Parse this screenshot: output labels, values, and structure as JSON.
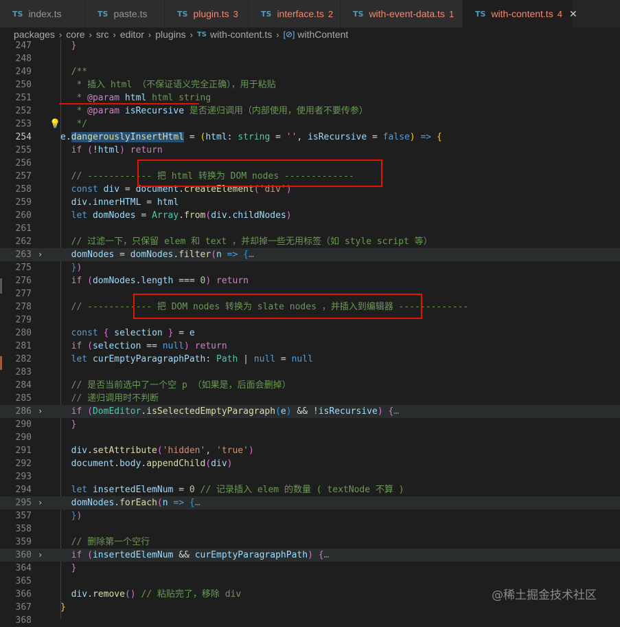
{
  "tabs": [
    {
      "label": "index.ts",
      "count": "",
      "error": false,
      "active": false,
      "width": 124
    },
    {
      "label": "paste.ts",
      "count": "",
      "error": false,
      "active": false,
      "width": 116
    },
    {
      "label": "plugin.ts",
      "count": "3",
      "error": true,
      "active": false,
      "width": 122
    },
    {
      "label": "interface.ts",
      "count": "2",
      "error": true,
      "active": false,
      "width": 134
    },
    {
      "label": "with-event-data.ts",
      "count": "1",
      "error": true,
      "active": false,
      "width": 178
    },
    {
      "label": "with-content.ts",
      "count": "4",
      "error": true,
      "active": true,
      "width": 160
    }
  ],
  "tab_ts_glyph": "TS",
  "tab_close_glyph": "✕",
  "breadcrumb": {
    "items": [
      "packages",
      "core",
      "src",
      "editor",
      "plugins"
    ],
    "file": "with-content.ts",
    "symbol": "withContent",
    "sep": "›"
  },
  "lines": [
    {
      "n": "247",
      "fold": false,
      "hl": false,
      "html": "  <span class=\"b2\">}</span>"
    },
    {
      "n": "248",
      "fold": false,
      "hl": false,
      "html": ""
    },
    {
      "n": "249",
      "fold": false,
      "hl": false,
      "html": "  <span class=\"c\">/**</span>"
    },
    {
      "n": "250",
      "fold": false,
      "hl": false,
      "html": "  <span class=\"c\"> * 插入 html （不保证语义完全正确），用于粘贴</span>"
    },
    {
      "n": "251",
      "fold": false,
      "hl": false,
      "html": "  <span class=\"c\"> * </span><span class=\"p\">@param</span><span class=\"v\"> html</span><span class=\"c\"> html string</span>"
    },
    {
      "n": "252",
      "fold": false,
      "hl": false,
      "html": "  <span class=\"c\"> * </span><span class=\"p\">@param</span><span class=\"v\"> isRecursive</span><span class=\"c\"> 是否递归调用（内部使用，使用者不要传参）</span>"
    },
    {
      "n": "253",
      "fold": false,
      "hl": false,
      "bulb": true,
      "html": "  <span class=\"c\"> */</span>"
    },
    {
      "n": "254",
      "fold": false,
      "hl": false,
      "cur": true,
      "html": "<span class=\"v\">e</span>.<span class=\"selword\"><span class=\"f\">dangerouslyInsertHtml</span></span> = <span class=\"b1\">(</span><span class=\"v\">html</span>: <span class=\"t\">string</span> = <span class=\"s\">''</span>, <span class=\"v\">isRecursive</span> = <span class=\"k\">false</span><span class=\"b1\">)</span> <span class=\"k\">=></span> <span class=\"b1\">{</span>"
    },
    {
      "n": "255",
      "fold": false,
      "hl": false,
      "html": "  <span class=\"p\">if</span> <span class=\"b2\">(</span>!<span class=\"v\">html</span><span class=\"b2\">)</span> <span class=\"p\">return</span>"
    },
    {
      "n": "256",
      "fold": false,
      "hl": false,
      "html": ""
    },
    {
      "n": "257",
      "fold": false,
      "hl": false,
      "html": "  <span class=\"c\">// ------------ 把 html 转换为 DOM nodes -------------</span>"
    },
    {
      "n": "258",
      "fold": false,
      "hl": false,
      "html": "  <span class=\"k\">const</span> <span class=\"v\">div</span> = <span class=\"v\">document</span>.<span class=\"f\">createElement</span><span class=\"b2\">(</span><span class=\"s\">'div'</span><span class=\"b2\">)</span>"
    },
    {
      "n": "259",
      "fold": false,
      "hl": false,
      "html": "  <span class=\"v\">div</span>.<span class=\"v\">innerHTML</span> = <span class=\"v\">html</span>"
    },
    {
      "n": "260",
      "fold": false,
      "hl": false,
      "html": "  <span class=\"k\">let</span> <span class=\"v\">domNodes</span> = <span class=\"t\">Array</span>.<span class=\"f\">from</span><span class=\"b2\">(</span><span class=\"v\">div</span>.<span class=\"v\">childNodes</span><span class=\"b2\">)</span>"
    },
    {
      "n": "261",
      "fold": false,
      "hl": false,
      "html": ""
    },
    {
      "n": "262",
      "fold": false,
      "hl": false,
      "html": "  <span class=\"c\">// 过滤一下，只保留 elem 和 text ，并却掉一些无用标签（如 style script 等）</span>"
    },
    {
      "n": "263",
      "fold": true,
      "hl": true,
      "html": "  <span class=\"v\">domNodes</span> = <span class=\"v\">domNodes</span>.<span class=\"f\">filter</span><span class=\"b2\">(</span><span class=\"v\">n</span> <span class=\"k\">=></span> <span class=\"b3\">{</span><span class=\"dd\">…</span>"
    },
    {
      "n": "275",
      "fold": false,
      "hl": false,
      "html": "  <span class=\"b3\">}</span><span class=\"b2\">)</span>"
    },
    {
      "n": "276",
      "fold": false,
      "hl": false,
      "html": "  <span class=\"p\">if</span> <span class=\"b2\">(</span><span class=\"v\">domNodes</span>.<span class=\"v\">length</span> === <span class=\"n\">0</span><span class=\"b2\">)</span> <span class=\"p\">return</span>"
    },
    {
      "n": "277",
      "fold": false,
      "hl": false,
      "html": ""
    },
    {
      "n": "278",
      "fold": false,
      "hl": false,
      "html": "  <span class=\"c\">// ------------ 把 DOM nodes 转换为 slate nodes ，并插入到编辑器 -------------</span>"
    },
    {
      "n": "279",
      "fold": false,
      "hl": false,
      "html": ""
    },
    {
      "n": "280",
      "fold": false,
      "hl": false,
      "html": "  <span class=\"k\">const</span> <span class=\"b2\">{</span> <span class=\"v\">selection</span> <span class=\"b2\">}</span> = <span class=\"v\">e</span>"
    },
    {
      "n": "281",
      "fold": false,
      "hl": false,
      "html": "  <span class=\"p\">if</span> <span class=\"b2\">(</span><span class=\"v\">selection</span> == <span class=\"k\">null</span><span class=\"b2\">)</span> <span class=\"p\">return</span>"
    },
    {
      "n": "282",
      "fold": false,
      "hl": false,
      "html": "  <span class=\"k\">let</span> <span class=\"v\">curEmptyParagraphPath</span>: <span class=\"t\">Path</span> | <span class=\"k\">null</span> = <span class=\"k\">null</span>"
    },
    {
      "n": "283",
      "fold": false,
      "hl": false,
      "html": ""
    },
    {
      "n": "284",
      "fold": false,
      "hl": false,
      "html": "  <span class=\"c\">// 是否当前选中了一个空 p （如果是，后面会删掉）</span>"
    },
    {
      "n": "285",
      "fold": false,
      "hl": false,
      "html": "  <span class=\"c\">// 递归调用时不判断</span>"
    },
    {
      "n": "286",
      "fold": true,
      "hl": true,
      "html": "  <span class=\"p\">if</span> <span class=\"b2\">(</span><span class=\"t\">DomEditor</span>.<span class=\"f\">isSelectedEmptyParagraph</span><span class=\"b3\">(</span><span class=\"v\">e</span><span class=\"b3\">)</span> && !<span class=\"v\">isRecursive</span><span class=\"b2\">)</span> <span class=\"b2\">{</span><span class=\"dd\">…</span>"
    },
    {
      "n": "290",
      "fold": false,
      "hl": false,
      "html": "  <span class=\"b2\">}</span>"
    },
    {
      "n": "290",
      "fold": false,
      "hl": false,
      "html": ""
    },
    {
      "n": "291",
      "fold": false,
      "hl": false,
      "html": "  <span class=\"v\">div</span>.<span class=\"f\">setAttribute</span><span class=\"b2\">(</span><span class=\"s\">'hidden'</span>, <span class=\"s\">'true'</span><span class=\"b2\">)</span>"
    },
    {
      "n": "292",
      "fold": false,
      "hl": false,
      "html": "  <span class=\"v\">document</span>.<span class=\"v\">body</span>.<span class=\"f\">appendChild</span><span class=\"b2\">(</span><span class=\"v\">div</span><span class=\"b2\">)</span>"
    },
    {
      "n": "293",
      "fold": false,
      "hl": false,
      "html": ""
    },
    {
      "n": "294",
      "fold": false,
      "hl": false,
      "html": "  <span class=\"k\">let</span> <span class=\"v\">insertedElemNum</span> = <span class=\"n\">0</span> <span class=\"c\">// 记录插入 elem 的数量 ( textNode 不算 )</span>"
    },
    {
      "n": "295",
      "fold": true,
      "hl": true,
      "html": "  <span class=\"v\">domNodes</span>.<span class=\"f\">forEach</span><span class=\"b2\">(</span><span class=\"v\">n</span> <span class=\"k\">=></span> <span class=\"b3\">{</span><span class=\"dd\">…</span>"
    },
    {
      "n": "357",
      "fold": false,
      "hl": false,
      "html": "  <span class=\"b3\">}</span><span class=\"b2\">)</span>"
    },
    {
      "n": "358",
      "fold": false,
      "hl": false,
      "html": ""
    },
    {
      "n": "359",
      "fold": false,
      "hl": false,
      "html": "  <span class=\"c\">// 删除第一个空行</span>"
    },
    {
      "n": "360",
      "fold": true,
      "hl": true,
      "html": "  <span class=\"p\">if</span> <span class=\"b2\">(</span><span class=\"v\">insertedElemNum</span> && <span class=\"v\">curEmptyParagraphPath</span><span class=\"b2\">)</span> <span class=\"b2\">{</span><span class=\"dd\">…</span>"
    },
    {
      "n": "364",
      "fold": false,
      "hl": false,
      "html": "  <span class=\"b2\">}</span>"
    },
    {
      "n": "365",
      "fold": false,
      "hl": false,
      "html": ""
    },
    {
      "n": "366",
      "fold": false,
      "hl": false,
      "html": "  <span class=\"v\">div</span>.<span class=\"f\">remove</span><span class=\"b2\">()</span> <span class=\"c\">// 粘贴完了，移除 div</span>"
    },
    {
      "n": "367",
      "fold": false,
      "hl": false,
      "html": "<span class=\"b1\">}</span>"
    },
    {
      "n": "368",
      "fold": false,
      "hl": false,
      "html": ""
    }
  ],
  "fold_glyph": "›",
  "bulb_glyph": "💡",
  "watermark": "@稀土掘金技术社区"
}
